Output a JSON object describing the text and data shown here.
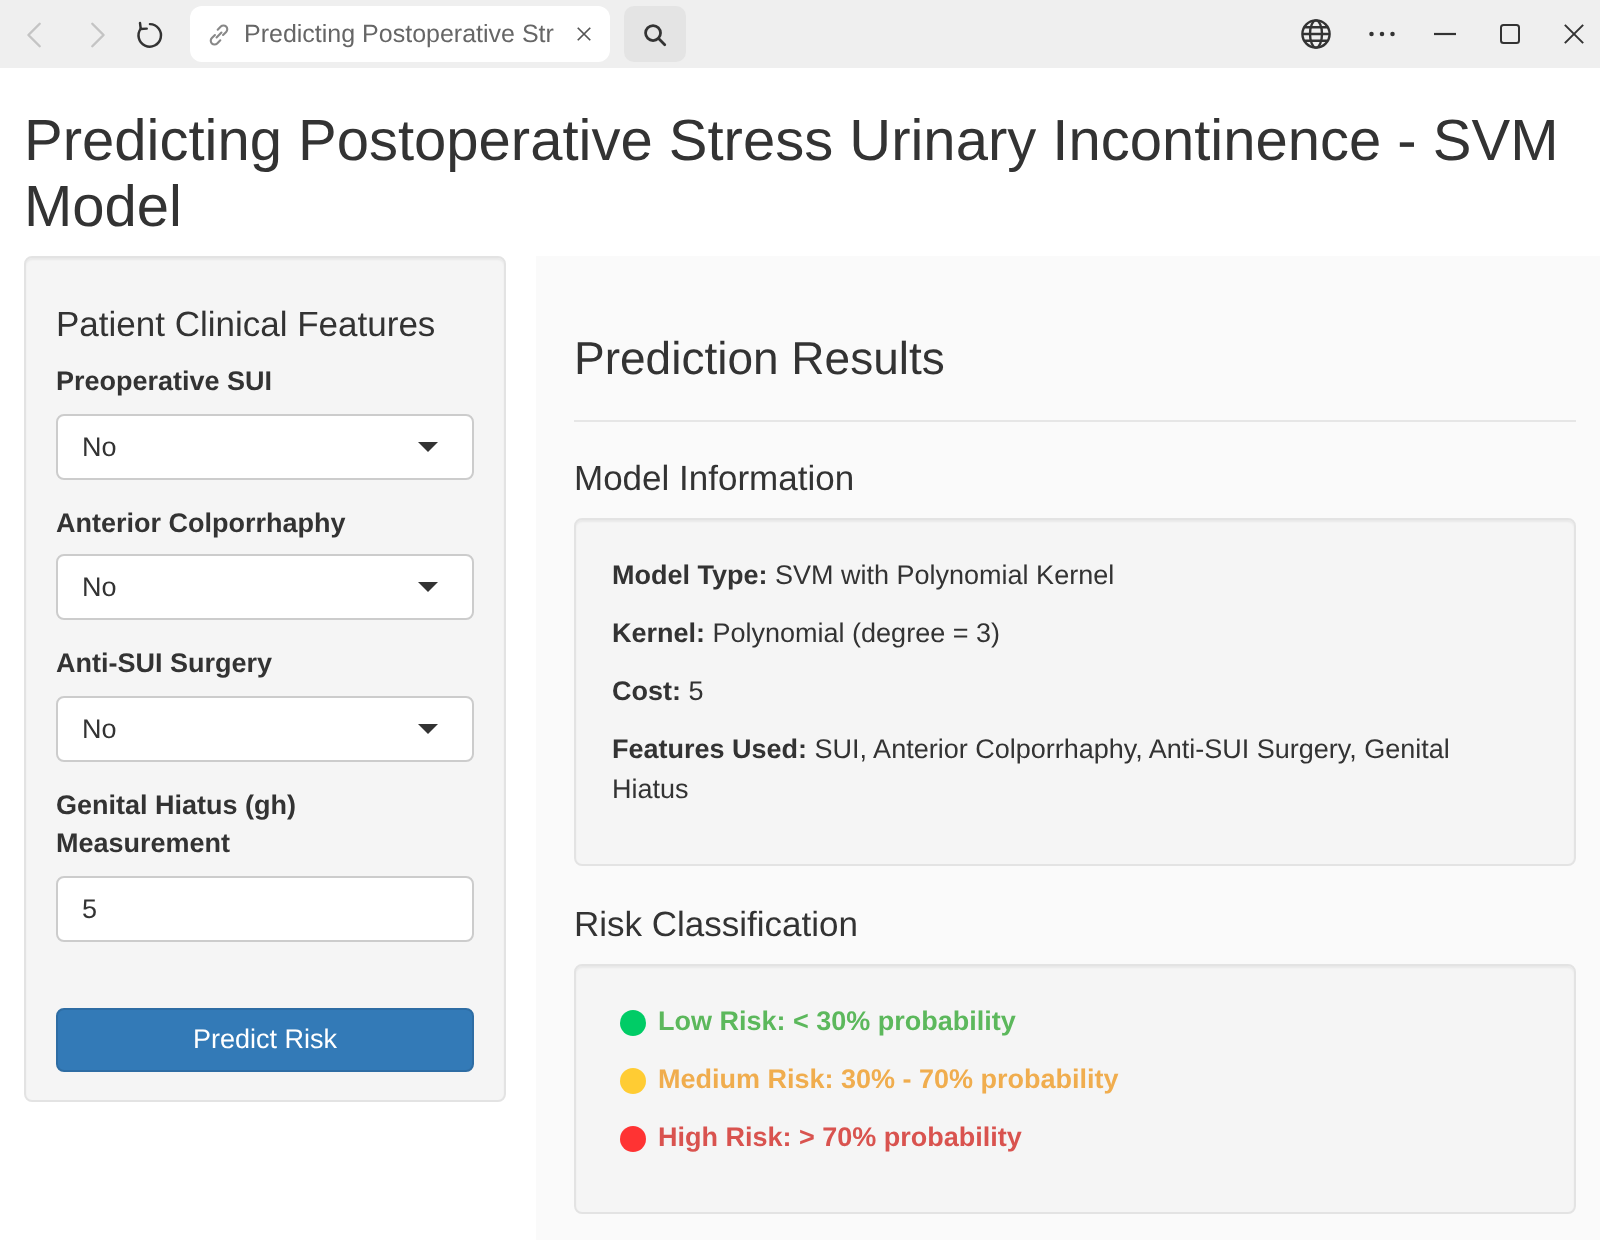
{
  "browser": {
    "nav": [
      {
        "kind": "back",
        "disabled": true
      },
      {
        "kind": "forward",
        "disabled": true
      },
      {
        "kind": "reload",
        "disabled": false
      }
    ],
    "tab": {
      "title": "Predicting Postoperative Str"
    }
  },
  "title": "Predicting Postoperative Stress Urinary Incontinence - SVM Model",
  "sidebar": {
    "heading": "Patient Clinical Features",
    "fields": [
      {
        "kind": "select",
        "label": "Preoperative SUI",
        "value": "No"
      },
      {
        "kind": "select",
        "label": "Anterior Colporrhaphy",
        "value": "No"
      },
      {
        "kind": "select",
        "label": "Anti-SUI Surgery",
        "value": "No"
      },
      {
        "kind": "number",
        "label": "Genital Hiatus (gh) Measurement",
        "value": "5"
      }
    ],
    "button": "Predict Risk"
  },
  "results": {
    "title": "Prediction Results",
    "model_info": {
      "heading": "Model Information",
      "lines": [
        "**Model Type:** SVM with Polynomial Kernel",
        "**Kernel:** Polynomial (degree = 3)",
        "**Cost:** 5",
        "**Features Used:** SUI, Anterior Colporrhaphy, Anti-SUI Surgery, Genital Hiatus"
      ]
    },
    "risk": {
      "heading": "Risk Classification",
      "levels": [
        {
          "label": "Low Risk: < 30% probability",
          "color": "#5cb85c",
          "dot": {
            "color": "#00cc66"
          }
        },
        {
          "label": "Medium Risk: 30% - 70% probability",
          "color": "#f0ad4e",
          "dot": {
            "color": "#ffcc33"
          }
        },
        {
          "label": "High Risk: > 70% probability",
          "color": "#d9534f",
          "dot": {
            "color": "#ff3333"
          }
        }
      ]
    }
  }
}
